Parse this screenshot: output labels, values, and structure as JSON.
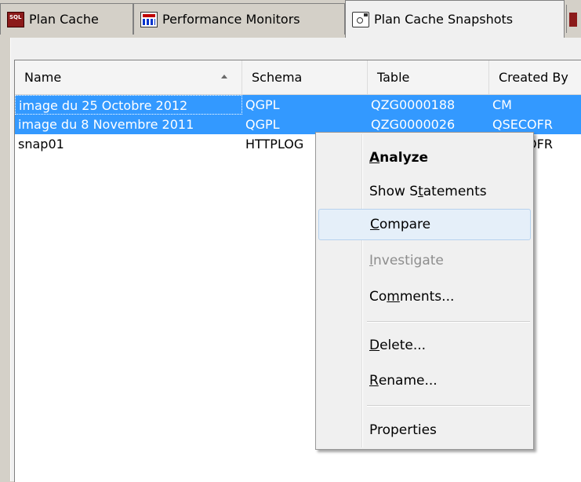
{
  "tabs": [
    {
      "label": "Plan Cache",
      "icon": "sql-plan-cache-icon"
    },
    {
      "label": "Performance Monitors",
      "icon": "performance-monitor-icon"
    },
    {
      "label": "Plan Cache Snapshots",
      "icon": "snapshot-camera-icon",
      "selected": true
    }
  ],
  "table": {
    "columns": [
      "Name",
      "Schema",
      "Table",
      "Created By"
    ],
    "sort": {
      "column": "Name",
      "direction": "ascending"
    },
    "rows": [
      {
        "name": "image du 25 Octobre 2012",
        "schema": "QGPL",
        "table": "QZG0000188",
        "created_by": "CM",
        "selected": true
      },
      {
        "name": "image du 8 Novembre 2011",
        "schema": "QGPL",
        "table": "QZG0000026",
        "created_by": "QSECOFR",
        "selected": true
      },
      {
        "name": "snap01",
        "schema": "HTTPLOG",
        "table": "",
        "created_by": "QSECOFR",
        "selected": false
      }
    ]
  },
  "context_menu": {
    "groups": [
      [
        {
          "pre": "",
          "key": "A",
          "post": "nalyze",
          "default": true
        },
        {
          "pre": "Show S",
          "key": "t",
          "post": "atements"
        },
        {
          "pre": "",
          "key": "C",
          "post": "ompare",
          "hover": true
        },
        {
          "pre": "",
          "key": "I",
          "post": "nvestigate",
          "disabled": true
        },
        {
          "pre": "Co",
          "key": "m",
          "post": "ments..."
        }
      ],
      [
        {
          "pre": "",
          "key": "D",
          "post": "elete..."
        },
        {
          "pre": "",
          "key": "R",
          "post": "ename..."
        }
      ],
      [
        {
          "pre": "Properties",
          "key": "",
          "post": ""
        }
      ]
    ]
  },
  "colors": {
    "selection": "#3399ff",
    "menu_hover": "#e5eff9",
    "window_bg": "#d4d0c8"
  }
}
